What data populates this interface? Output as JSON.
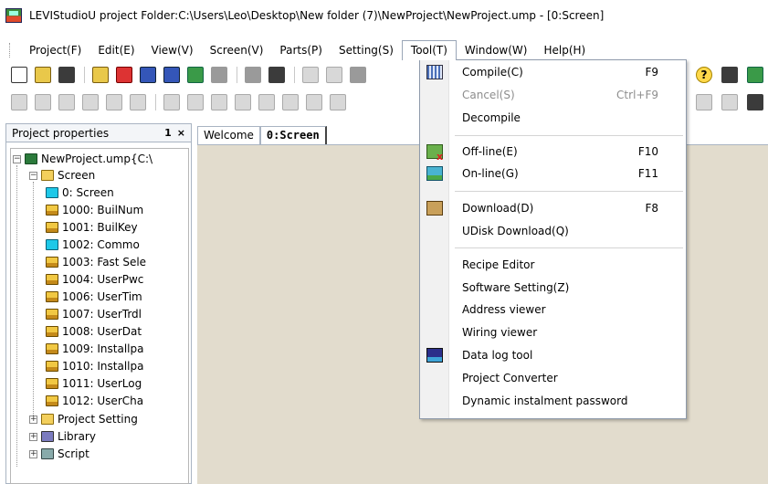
{
  "window": {
    "title": "LEVIStudioU  project Folder:C:\\Users\\Leo\\Desktop\\New folder (7)\\NewProject\\NewProject.ump  - [0:Screen]"
  },
  "menubar": {
    "items": [
      {
        "label": "Project(F)"
      },
      {
        "label": "Edit(E)"
      },
      {
        "label": "View(V)"
      },
      {
        "label": "Screen(V)"
      },
      {
        "label": "Parts(P)"
      },
      {
        "label": "Setting(S)"
      },
      {
        "label": "Tool(T)"
      },
      {
        "label": "Window(W)"
      },
      {
        "label": "Help(H)"
      }
    ],
    "open_menu": "Tool(T)"
  },
  "toolbar": {
    "help_glyph": "?"
  },
  "project_panel": {
    "title": "Project properties",
    "pin_glyph": "1",
    "close_glyph": "×",
    "tree": {
      "root": "NewProject.ump{C:\\",
      "screen_folder": "Screen",
      "screens": [
        "0: Screen",
        "1000: BuilNum",
        "1001: BuilKey",
        "1002: Commo",
        "1003: Fast Sele",
        "1004: UserPwc",
        "1006: UserTim",
        "1007: UserTrdl",
        "1008: UserDat",
        "1009: Installpa",
        "1010: Installpa",
        "1011: UserLog",
        "1012: UserCha"
      ],
      "project_setting": "Project Setting",
      "library": "Library",
      "script": "Script"
    }
  },
  "document": {
    "tabs": [
      "Welcome",
      "0:Screen"
    ]
  },
  "tool_menu": {
    "items": [
      {
        "label": "Compile(C)",
        "shortcut": "F9",
        "icon": "compile-icon",
        "enabled": true
      },
      {
        "label": "Cancel(S)",
        "shortcut": "Ctrl+F9",
        "enabled": false
      },
      {
        "label": "Decompile",
        "shortcut": "",
        "enabled": true
      },
      {
        "label": "Off-line(E)",
        "shortcut": "F10",
        "icon": "offline-simulation-icon",
        "enabled": true
      },
      {
        "label": "On-line(G)",
        "shortcut": "F11",
        "icon": "online-simulation-icon",
        "enabled": true
      },
      {
        "label": "Download(D)",
        "shortcut": "F8",
        "icon": "download-icon",
        "enabled": true
      },
      {
        "label": "UDisk Download(Q)",
        "shortcut": "",
        "enabled": true
      },
      {
        "label": "Recipe Editor",
        "shortcut": "",
        "enabled": true
      },
      {
        "label": "Software Setting(Z)",
        "shortcut": "",
        "enabled": true
      },
      {
        "label": "Address viewer",
        "shortcut": "",
        "enabled": true
      },
      {
        "label": "Wiring viewer",
        "shortcut": "",
        "enabled": true
      },
      {
        "label": "Data log tool",
        "shortcut": "",
        "icon": "data-log-icon",
        "enabled": true
      },
      {
        "label": "Project Converter",
        "shortcut": "",
        "enabled": true
      },
      {
        "label": "Dynamic instalment password",
        "shortcut": "",
        "enabled": true
      }
    ]
  }
}
